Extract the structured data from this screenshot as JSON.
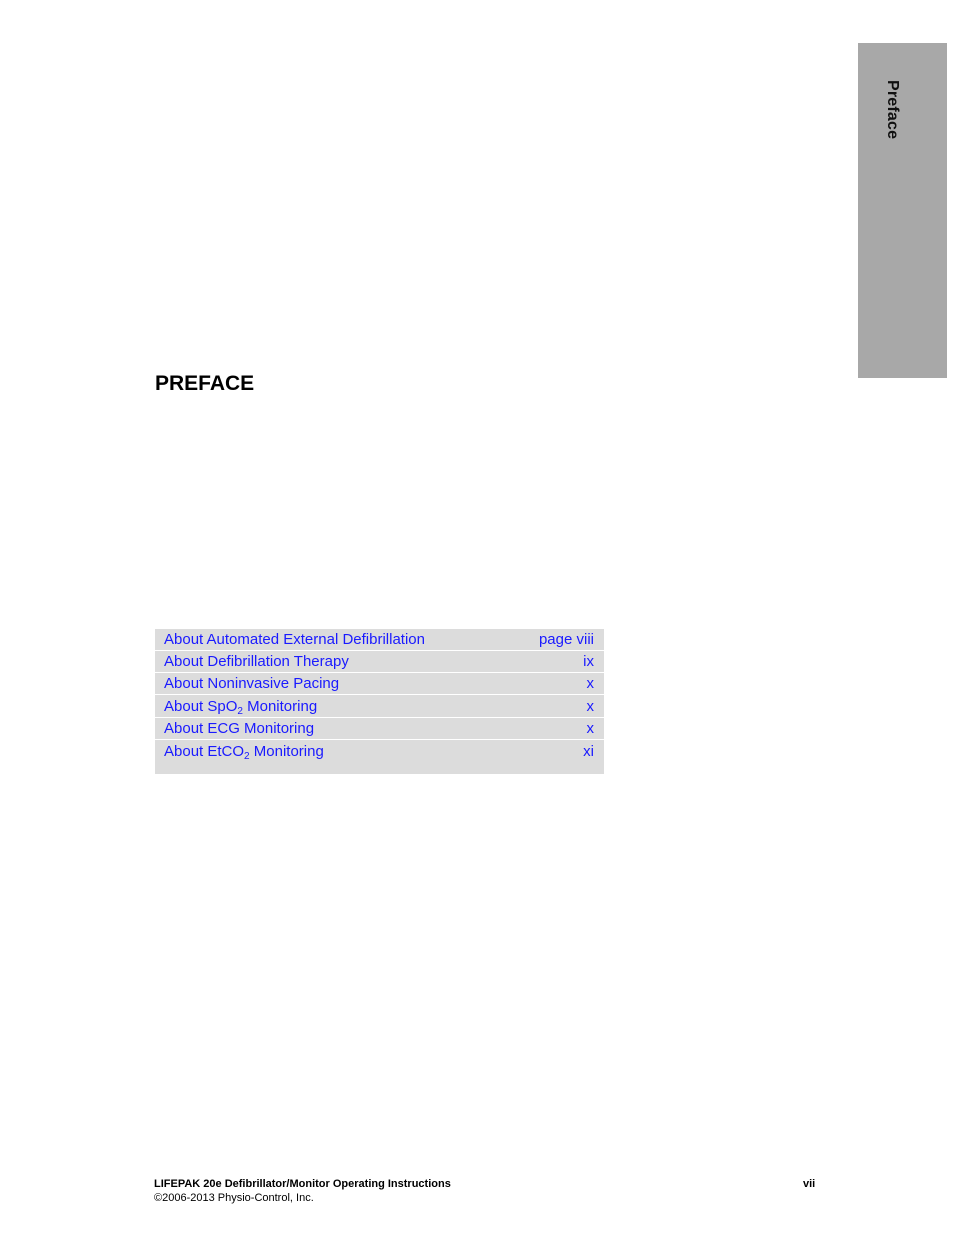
{
  "side_tab": {
    "label": "Preface",
    "background_color": "#a8a8a8"
  },
  "page_title": "PREFACE",
  "toc": {
    "link_color": "#1a1aff",
    "row_background": "#dcdcdc",
    "items": [
      {
        "title": "About Automated External Defibrillation",
        "page": "page viii"
      },
      {
        "title": "About Defibrillation Therapy",
        "page": "ix"
      },
      {
        "title": "About Noninvasive Pacing",
        "page": "x"
      },
      {
        "title_pre": "About SpO",
        "title_sub": "2",
        "title_post": " Monitoring",
        "page": "x"
      },
      {
        "title": "About ECG Monitoring",
        "page": "x"
      },
      {
        "title_pre": "About EtCO",
        "title_sub": "2",
        "title_post": " Monitoring",
        "page": "xi"
      }
    ]
  },
  "footer": {
    "document_title": "LIFEPAK 20e Defibrillator/Monitor Operating Instructions",
    "page_number": "vii",
    "copyright": "©2006-2013 Physio-Control, Inc."
  }
}
